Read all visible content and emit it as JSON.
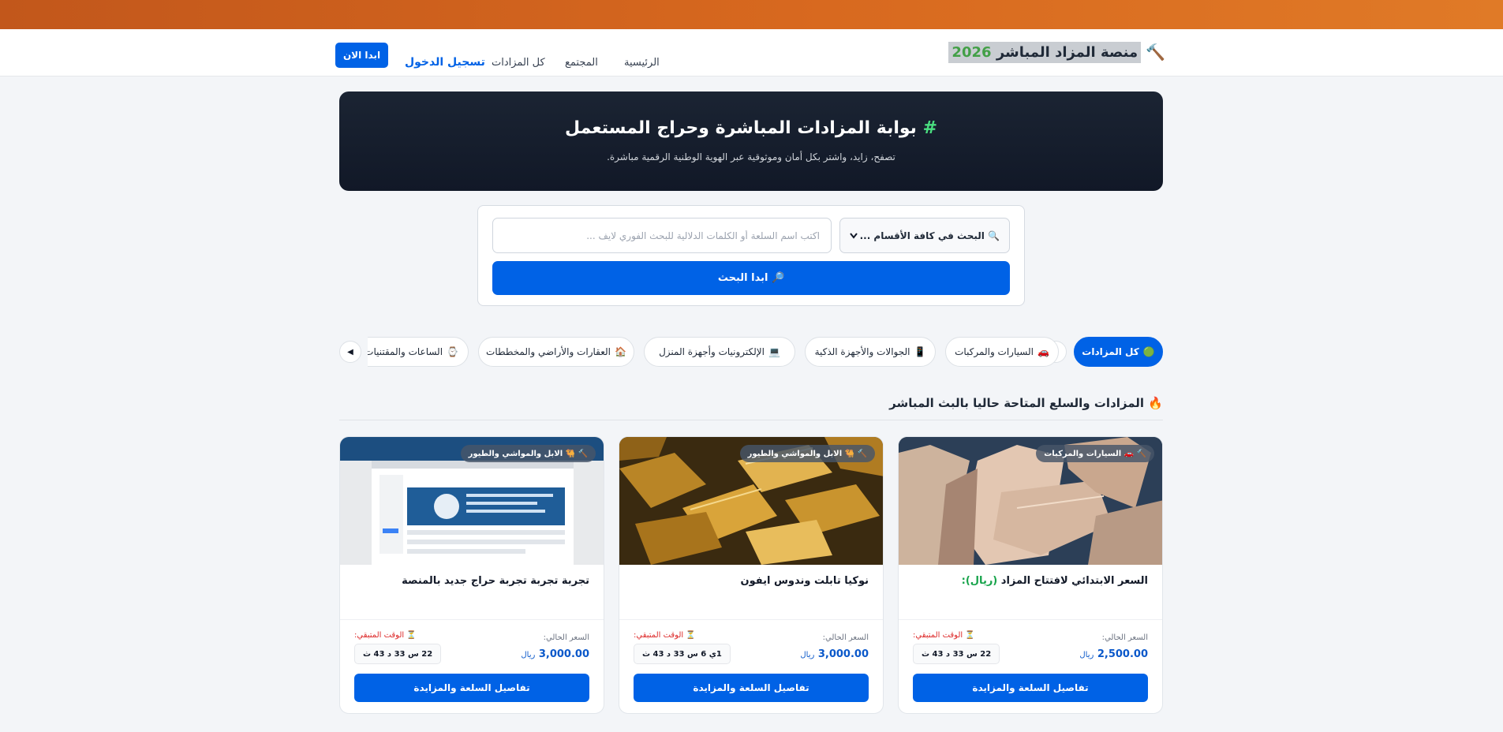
{
  "header": {
    "brand_name": "منصة المزاد المباشر",
    "brand_year": "2026",
    "nav": {
      "home": "الرئيسية",
      "community": "المجتمع",
      "all_auctions": "كل المزادات",
      "login": "تسجيل الدخول",
      "start": "ابدا الان"
    }
  },
  "hero": {
    "hash": "#",
    "title": "بوابة المزادات المباشرة وحراج المستعمل",
    "subtitle": "تصفح، زايد، واشتر بكل أمان وموثوقية عبر الهوية الوطنية الرقمية مباشرة."
  },
  "search": {
    "category_select": "🔍 البحث في كافة الأقسام ...",
    "input_placeholder": "اكتب اسم السلعة أو الكلمات الدلالية للبحث الفوري لايف ...",
    "button_label": "🔎 ابدا البحث"
  },
  "categories": [
    {
      "label": "كل المزادات",
      "icon": "🟢",
      "active": true
    },
    {
      "label": "السيارات والمركبات",
      "icon": "🚗"
    },
    {
      "label": "الجوالات والأجهزة الذكية",
      "icon": "📱"
    },
    {
      "label": "الإلكترونيات وأجهزة المنزل",
      "icon": "💻"
    },
    {
      "label": "العقارات والأراضي والمخططات",
      "icon": "🏠"
    },
    {
      "label": "الساعات والمقتنيات",
      "icon": "⌚"
    }
  ],
  "section": {
    "icon": "🔥",
    "title": "المزادات والسلع المتاحة حاليا بالبث المباشر"
  },
  "cards": [
    {
      "badge": "🔨 🚗 السيارات والمركبات",
      "title": "السعر الابتدائي لافتتاح المزاد",
      "title_suffix": "(ريال):",
      "price_label": "السعر الحالي:",
      "price": "2,500.00",
      "currency": "ريال",
      "time_label": "⏳ الوقت المتبقي:",
      "time": "22 س 33 د 43 ث",
      "button": "تفاصيل السلعة والمزايدة"
    },
    {
      "badge": "🔨 🐫 الابل والمواشي والطيور",
      "title": "نوكيا تابلت وندوس ايفون",
      "title_suffix": "",
      "price_label": "السعر الحالي:",
      "price": "3,000.00",
      "currency": "ريال",
      "time_label": "⏳ الوقت المتبقي:",
      "time": "1ي 6 س 33 د 43 ث",
      "button": "تفاصيل السلعة والمزايدة"
    },
    {
      "badge": "🔨 🐫 الابل والمواشي والطيور",
      "title": "تجربة تجربة تجربة حراج جديد بالمنصة",
      "title_suffix": "",
      "price_label": "السعر الحالي:",
      "price": "3,000.00",
      "currency": "ريال",
      "time_label": "⏳ الوقت المتبقي:",
      "time": "22 س 33 د 43 ث",
      "button": "تفاصيل السلعة والمزايدة"
    }
  ],
  "colors": {
    "accent": "#0062e6",
    "header_strip": "#d8691f",
    "hero_bg": "#151d2b",
    "success": "#43a047",
    "danger": "#dc2626"
  }
}
